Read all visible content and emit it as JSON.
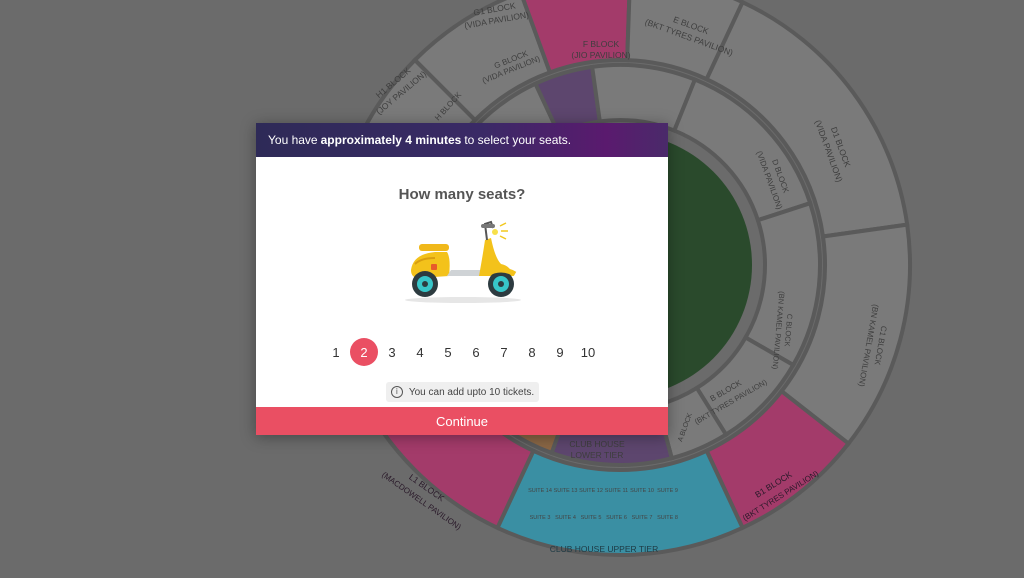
{
  "stadium": {
    "blocks": [
      {
        "id": "g1",
        "name": "G1 BLOCK",
        "sub": "(VIDA PAVILION)"
      },
      {
        "id": "h1",
        "name": "H1 BLOCK",
        "sub": "(JOY PAVILION)"
      },
      {
        "id": "g",
        "name": "G BLOCK",
        "sub": "(VIDA PAVILION)"
      },
      {
        "id": "h",
        "name": "H BLOCK",
        "sub": ""
      },
      {
        "id": "f",
        "name": "F BLOCK",
        "sub": "(JIO PAVILION)"
      },
      {
        "id": "e",
        "name": "E BLOCK",
        "sub": "(BKT TYRES PAVILION)"
      },
      {
        "id": "d1",
        "name": "D1 BLOCK",
        "sub": "(VIDA PAVILION)"
      },
      {
        "id": "d",
        "name": "D BLOCK",
        "sub": "(VIDA PAVILION)"
      },
      {
        "id": "c",
        "name": "C BLOCK",
        "sub": "(BN KAMEL PAVILION)"
      },
      {
        "id": "c1",
        "name": "C1 BLOCK",
        "sub": "(BN KAMEL PAVILION)"
      },
      {
        "id": "b",
        "name": "B BLOCK",
        "sub": "(BKT TYRES PAVILION)"
      },
      {
        "id": "b1",
        "name": "B1 BLOCK",
        "sub": "(BKT TYRES PAVILION)"
      },
      {
        "id": "a",
        "name": "A BLOCK",
        "sub": "(PREMIUM BKT TYRES PAVILION)"
      },
      {
        "id": "l1",
        "name": "L1 BLOCK",
        "sub": "(MACDOWELL PAVILION)"
      },
      {
        "id": "chl",
        "name": "CLUB HOUSE",
        "sub": "LOWER TIER"
      },
      {
        "id": "chu",
        "name": "CLUB HOUSE UPPER TIER",
        "sub": ""
      }
    ],
    "suites_top": [
      "SUITE 14",
      "SUITE 13",
      "SUITE 12",
      "SUITE 11",
      "SUITE 10",
      "SUITE 9"
    ],
    "suites_bottom": [
      "SUITE 3",
      "SUITE 4",
      "SUITE 5",
      "SUITE 6",
      "SUITE 7",
      "SUITE 8"
    ]
  },
  "modal": {
    "header_prefix": "You have",
    "header_bold": "approximately 4 minutes",
    "header_suffix": "to select your seats.",
    "title": "How many seats?",
    "illustration": "scooter-illustration",
    "options": [
      "1",
      "2",
      "3",
      "4",
      "5",
      "6",
      "7",
      "8",
      "9",
      "10"
    ],
    "selected": "2",
    "info_icon": "info-icon",
    "info_text": "You can add upto 10 tickets.",
    "continue_label": "Continue"
  },
  "colors": {
    "accent": "#ea4f63",
    "header_start": "#2e2a57",
    "header_end": "#5a1a6e",
    "backdrop": "#6b6b6b",
    "pitch": "#2a4a2c",
    "pink_block": "#a33b6a",
    "cyan_block": "#3a8fa3",
    "purple_block": "#5d466e",
    "orange_block": "#8a6645"
  }
}
